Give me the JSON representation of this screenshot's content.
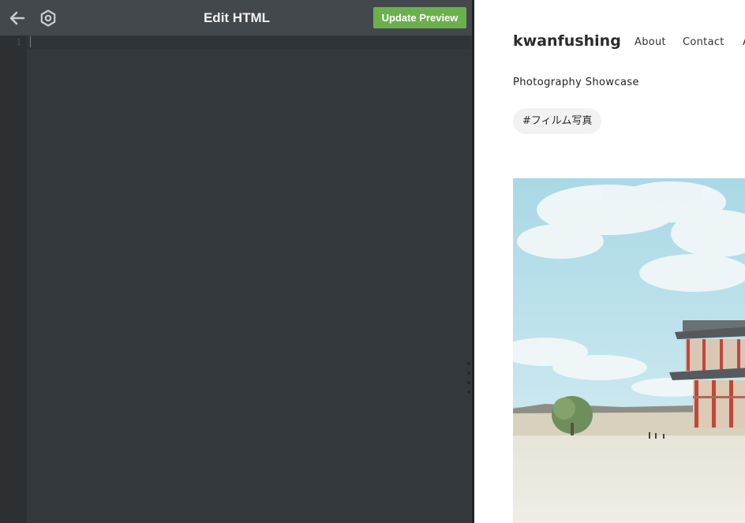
{
  "editor": {
    "title": "Edit HTML",
    "update_button": "Update Preview",
    "line_numbers": [
      "1"
    ],
    "icons": {
      "back": "arrow-left-icon",
      "settings": "gear-icon"
    },
    "accent_color": "#6ab04c"
  },
  "preview": {
    "brand": "kwanfushing",
    "nav": [
      "About",
      "Contact",
      "A"
    ],
    "subtitle": "Photography Showcase",
    "tag": "#フィルム写真"
  }
}
